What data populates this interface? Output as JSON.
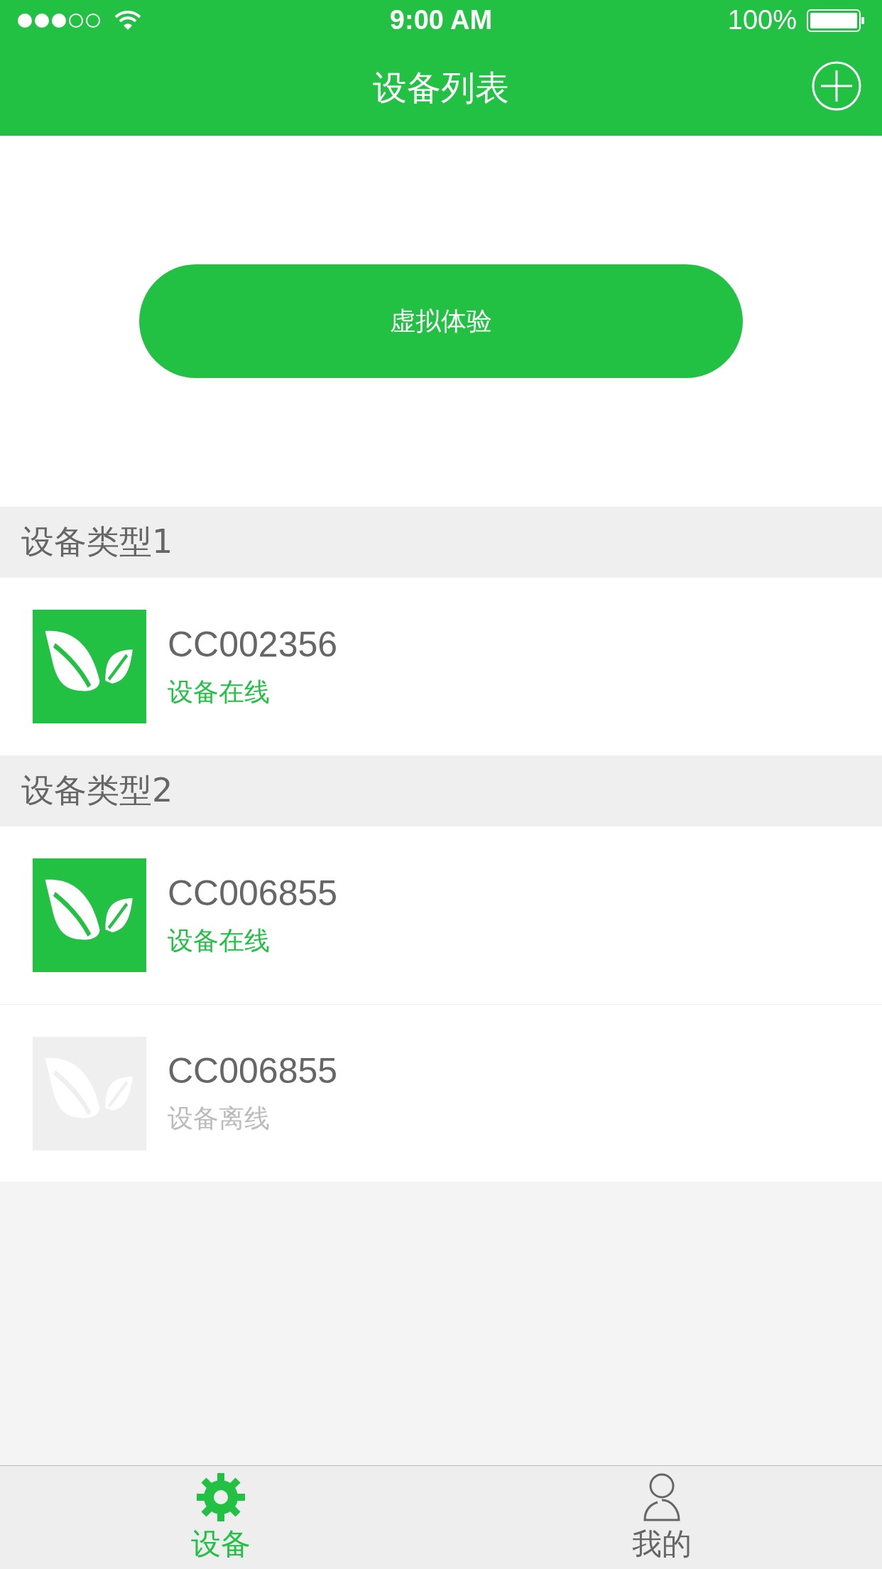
{
  "status_bar": {
    "time": "9:00 AM",
    "battery": "100%"
  },
  "nav_bar": {
    "title": "设备列表"
  },
  "demo_button": {
    "label": "虚拟体验"
  },
  "sections": [
    {
      "title": "设备类型1",
      "devices": [
        {
          "name": "CC002356",
          "status": "设备在线",
          "online": true
        }
      ]
    },
    {
      "title": "设备类型2",
      "devices": [
        {
          "name": "CC006855",
          "status": "设备在线",
          "online": true
        },
        {
          "name": "CC006855",
          "status": "设备离线",
          "online": false
        }
      ]
    }
  ],
  "tab_bar": [
    {
      "label": "设备",
      "kind": "gear",
      "selected": true
    },
    {
      "label": "我的",
      "kind": "person",
      "selected": false
    }
  ]
}
